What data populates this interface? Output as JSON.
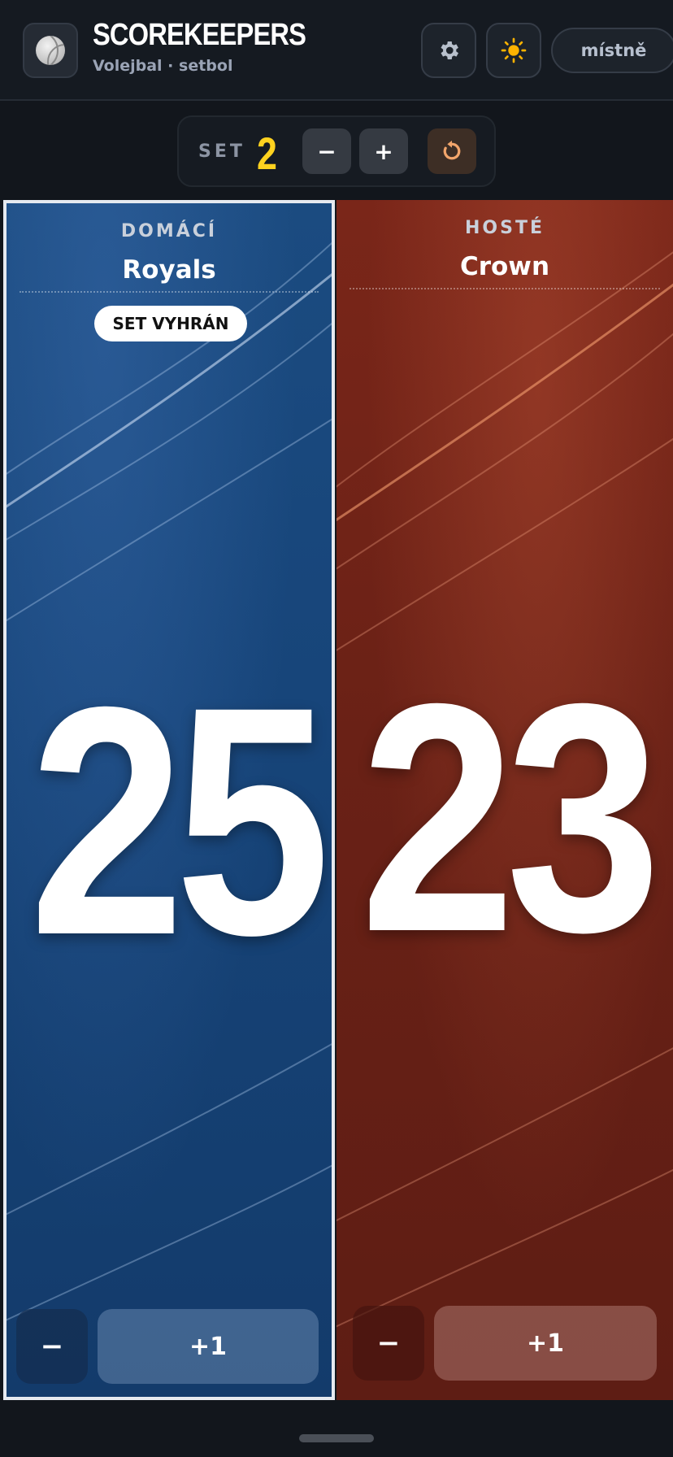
{
  "header": {
    "title": "SCOREKEEPERS",
    "subtitle": "Volejbal · setbol",
    "logo_icon": "volleyball-icon",
    "settings_icon": "gear-icon",
    "theme_icon": "sun-icon",
    "language_label": "místně"
  },
  "set_bar": {
    "label": "SET",
    "number": "2",
    "minus_label": "−",
    "plus_label": "+",
    "reset_icon": "reset-icon",
    "number_color": "#ffd21f"
  },
  "teams": [
    {
      "role": "DOMÁCÍ",
      "name": "Royals",
      "badge": "SET VYHRÁN",
      "score": "25",
      "minus_label": "−",
      "plus_label": "+1",
      "color": "#17457a"
    },
    {
      "role": "HOSTÉ",
      "name": "Crown",
      "score": "23",
      "minus_label": "−",
      "plus_label": "+1",
      "color": "#6a2116"
    }
  ]
}
